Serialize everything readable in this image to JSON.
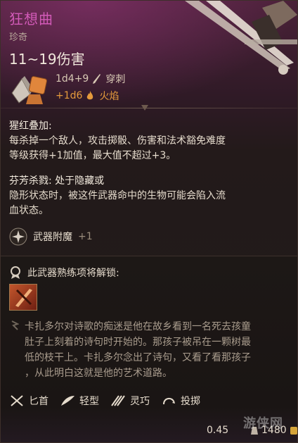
{
  "item": {
    "name": "狂想曲",
    "rarity": "珍奇",
    "damage_total": "11~19伤害"
  },
  "damage": {
    "base": {
      "dice": "1d4+9",
      "type": "穿刺"
    },
    "bonus": {
      "dice": "+1d6",
      "type": "火焰"
    }
  },
  "passives": [
    {
      "title": "猩红叠加:",
      "lines": [
        "每杀掉一个敌人，攻击掷骰、伤害和法术豁免难度",
        "等级获得+1加值，最大值不超过+3。"
      ]
    },
    {
      "title": "芬芳杀戮: 处于隐藏或",
      "lines": [
        "隐形状态时，被这件武器命中的生物可能会陷入流",
        "血状态。"
      ]
    }
  ],
  "enchantment": {
    "label": "武器附魔",
    "value": "+1"
  },
  "proficiency": {
    "label": "此武器熟练项将解锁:"
  },
  "lore": [
    "卡扎多尔对诗歌的痴迷是他在故乡看到一名死去孩童",
    "肚子上刻着的诗句时开始的。那孩子被吊在一颗树最",
    "低的枝干上。卡扎多尔念出了诗句，又看了看那孩子",
    "，从此明白这就是他的艺术道路。"
  ],
  "properties": [
    {
      "label": "匕首",
      "icon": "dagger-icon"
    },
    {
      "label": "轻型",
      "icon": "feather-icon"
    },
    {
      "label": "灵巧",
      "icon": "finesse-icon"
    },
    {
      "label": "投掷",
      "icon": "thrown-icon"
    }
  ],
  "footer": {
    "weight": "0.45",
    "value": "1480"
  },
  "watermark": "游侠网",
  "colors": {
    "name": "#d25ab8",
    "fire": "#e59a3c",
    "lore": "#a99c8d"
  }
}
